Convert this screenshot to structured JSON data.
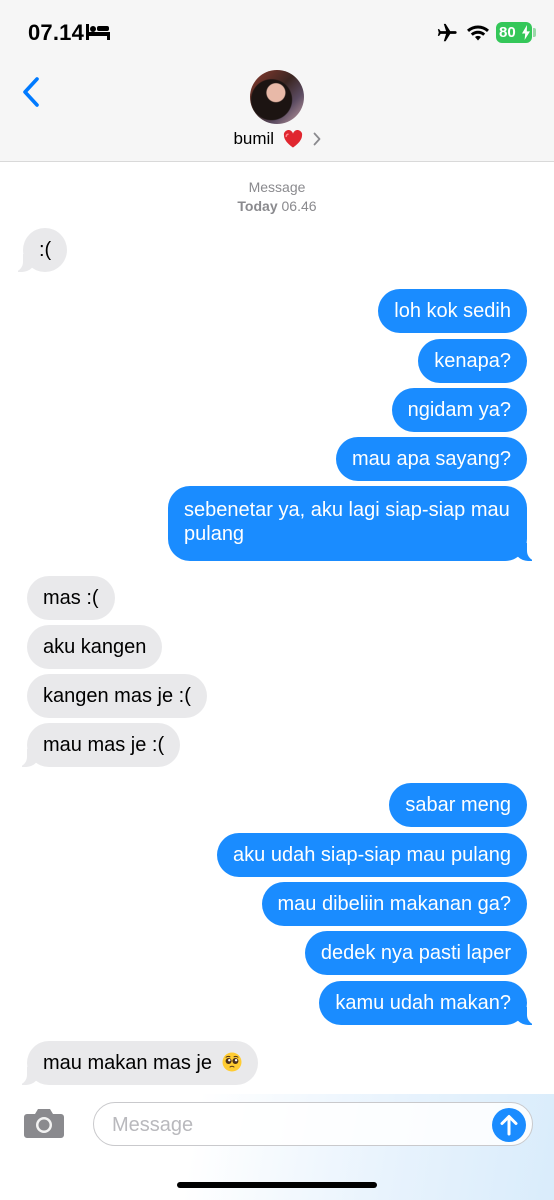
{
  "status_bar": {
    "time": "07.14",
    "battery": "80",
    "icons": [
      "bed-icon",
      "airplane-icon",
      "wifi-icon",
      "battery-icon"
    ]
  },
  "header": {
    "back_icon": "chevron-left-icon",
    "contact_name": "bumil",
    "contact_emoji": "red-heart",
    "chevron": "chevron-right-icon"
  },
  "thread": {
    "service": "Message",
    "day": "Today",
    "time": "06.46"
  },
  "messages": [
    {
      "from": "them",
      "text": ":("
    },
    {
      "from": "me",
      "text": "loh kok sedih"
    },
    {
      "from": "me",
      "text": "kenapa?"
    },
    {
      "from": "me",
      "text": "ngidam ya?"
    },
    {
      "from": "me",
      "text": "mau apa sayang?"
    },
    {
      "from": "me",
      "text": "sebenetar ya, aku lagi siap-siap mau pulang"
    },
    {
      "from": "them",
      "text": "mas :("
    },
    {
      "from": "them",
      "text": "aku kangen"
    },
    {
      "from": "them",
      "text": "kangen mas je :("
    },
    {
      "from": "them",
      "text": "mau mas je :("
    },
    {
      "from": "me",
      "text": "sabar meng"
    },
    {
      "from": "me",
      "text": "aku udah siap-siap mau pulang"
    },
    {
      "from": "me",
      "text": "mau dibeliin makanan ga?"
    },
    {
      "from": "me",
      "text": "dedek nya pasti laper"
    },
    {
      "from": "me",
      "text": "kamu udah makan?"
    },
    {
      "from": "them",
      "text": "mau makan mas je",
      "emoji": "pleading-face"
    }
  ],
  "composer": {
    "placeholder": "Message",
    "camera_icon": "camera-icon",
    "send_icon": "send-arrow-icon"
  },
  "colors": {
    "outgoing": "#1a8cff",
    "incoming": "#e9e9eb",
    "battery": "#34c759",
    "accent": "#007aff"
  }
}
